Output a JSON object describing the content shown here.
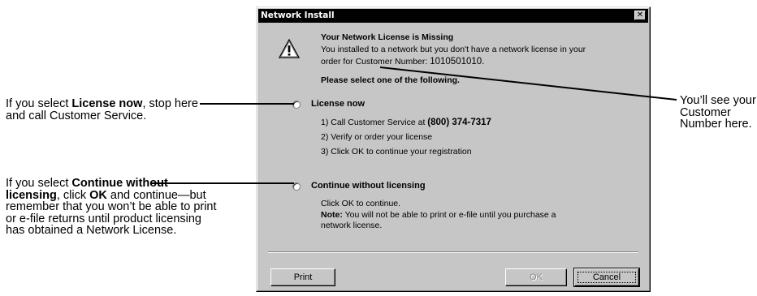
{
  "callouts": {
    "license_now": {
      "prefix": "If you select ",
      "bold": "License now",
      "suffix": ", stop here and call Customer Service."
    },
    "continue": {
      "prefix": "If you select ",
      "bold1": "Continue without licensing",
      "middle": ", click ",
      "bold2": "OK",
      "suffix": " and continue—but remember that you won’t be able to print or e-file returns until product licensing has obtained a Network License."
    },
    "customer_number": "You’ll see your Customer Number here."
  },
  "dialog": {
    "title": "Network Install",
    "close_glyph": "✕",
    "heading": "Your Network License is Missing",
    "message_line1": "You installed to a network but you don't have a network license in your",
    "message_line2_prefix": "order for Customer Number: ",
    "customer_number": "1010501010.",
    "instruction": "Please select one of the following.",
    "options": [
      {
        "label": "License now",
        "steps_prefix": "1) Call Customer Service at ",
        "phone": "(800) 374-7317",
        "step2": "2) Verify or order your license",
        "step3": "3) Click OK to continue your registration"
      },
      {
        "label": "Continue without licensing",
        "line1": "Click OK to continue.",
        "note_label": "Note:",
        "note_text": "  You will not be able to print or e-file until you purchase a",
        "note_line2": "network license."
      }
    ],
    "buttons": {
      "print": "Print",
      "ok": "OK",
      "cancel": "Cancel"
    }
  }
}
